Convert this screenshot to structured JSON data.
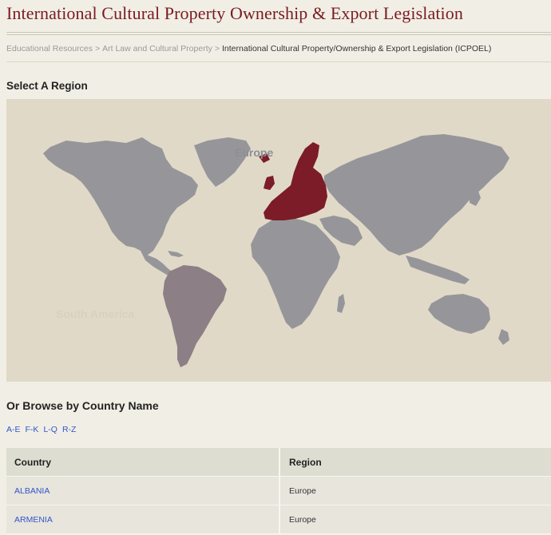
{
  "header": {
    "title": "International Cultural Property Ownership & Export Legislation"
  },
  "breadcrumb": {
    "items": [
      "Educational Resources",
      "Art Law and Cultural Property"
    ],
    "separator": ">",
    "current": "International Cultural Property/Ownership & Export Legislation (ICPOEL)"
  },
  "map": {
    "title": "Select A Region",
    "regions": {
      "europe": {
        "label": "Europe",
        "color": "#7b1c28"
      },
      "south_america": {
        "label": "South America",
        "color": "#8c7f85"
      }
    },
    "land_color": "#96969a",
    "background": "#e1d9c8"
  },
  "browse": {
    "title": "Or Browse by Country Name",
    "links": [
      "A-E",
      "F-K",
      "L-Q",
      "R-Z"
    ]
  },
  "table": {
    "headers": {
      "country": "Country",
      "region": "Region"
    },
    "rows": [
      {
        "country": "ALBANIA",
        "region": "Europe"
      },
      {
        "country": "ARMENIA",
        "region": "Europe"
      }
    ]
  }
}
